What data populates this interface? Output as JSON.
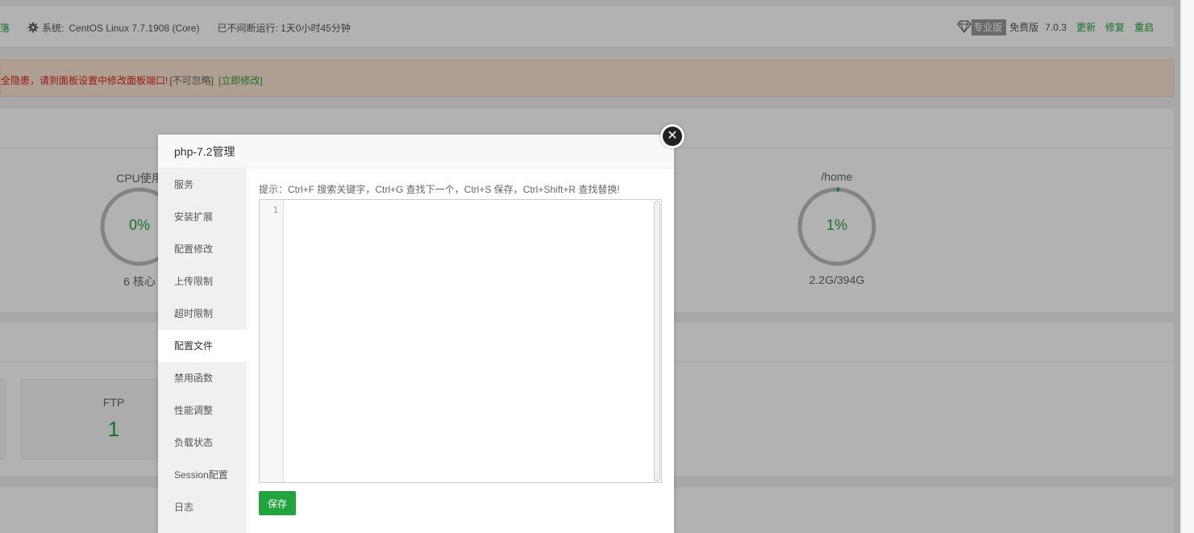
{
  "topbar": {
    "lead_fragment": "落",
    "system_label": "系统:",
    "system_value": "CentOS Linux 7.7.1908 (Core)",
    "uptime": "已不间断运行: 1天0小时45分钟",
    "badge": "专业版",
    "edition": "免费版",
    "version": "7.0.3",
    "update": "更新",
    "repair": "修复",
    "restart": "重启"
  },
  "warning": {
    "message": "全隐患，请到面板设置中修改面板端口!",
    "ignore": "[不可忽略]",
    "fix_now": "[立即修改]"
  },
  "status": {
    "gauges": [
      {
        "title": "CPU使用",
        "value": "0%",
        "sub": "6 核心",
        "percent": 0
      },
      {
        "title": "/home",
        "value": "1%",
        "sub": "2.2G/394G",
        "percent": 1
      }
    ]
  },
  "overview": {
    "cards": [
      {
        "name": "FTP",
        "value": "1"
      }
    ]
  },
  "modal": {
    "title": "php-7.2管理",
    "menu": [
      "服务",
      "安装扩展",
      "配置修改",
      "上传限制",
      "超时限制",
      "配置文件",
      "禁用函数",
      "性能调整",
      "负载状态",
      "Session配置",
      "日志"
    ],
    "active_index": 5,
    "tip": "提示：Ctrl+F 搜索关键字，Ctrl+G 查找下一个，Ctrl+S 保存，Ctrl+Shift+R 查找替换!",
    "editor": {
      "line_number": "1",
      "content": ""
    },
    "save_label": "保存",
    "close_glyph": "✕"
  },
  "colors": {
    "accent": "#20a53a",
    "warning_text": "#d9261c",
    "warning_bg": "#fbe2d2"
  }
}
